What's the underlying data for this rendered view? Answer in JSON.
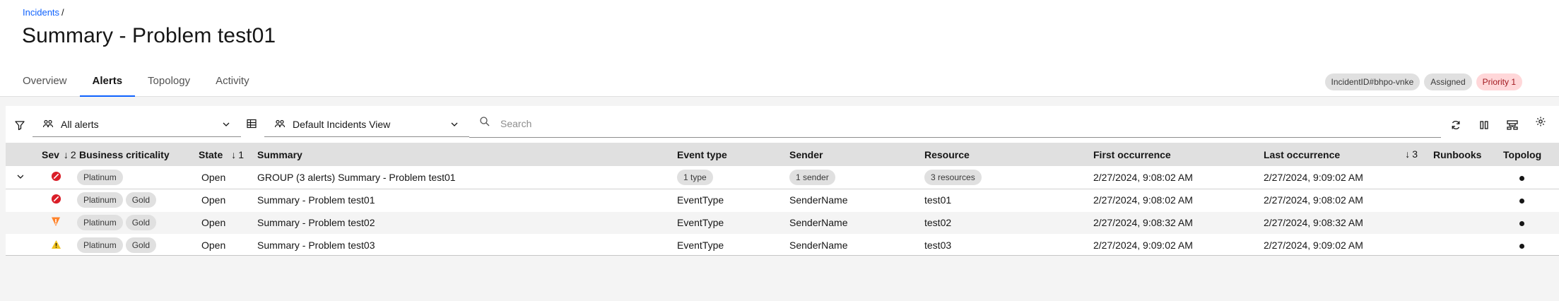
{
  "breadcrumb": {
    "link": "Incidents",
    "separator": "/"
  },
  "title": "Summary - Problem test01",
  "tabs": [
    {
      "label": "Overview",
      "active": false
    },
    {
      "label": "Alerts",
      "active": true
    },
    {
      "label": "Topology",
      "active": false
    },
    {
      "label": "Activity",
      "active": false
    }
  ],
  "tags": [
    {
      "label": "IncidentID#bhpo-vnke",
      "style": "gray"
    },
    {
      "label": "Assigned",
      "style": "gray"
    },
    {
      "label": "Priority 1",
      "style": "red"
    }
  ],
  "toolbar": {
    "filter_icon": "filter-icon",
    "alert_filter": "All alerts",
    "view_icon": "table-icon",
    "view_selector": "Default Incidents View",
    "search_placeholder": "Search",
    "actions": [
      "refresh-icon",
      "columns-icon",
      "group-by-icon",
      "settings-icon"
    ]
  },
  "columns": {
    "sev": "Sev",
    "sev_sort": "2",
    "business_criticality": "Business criticality",
    "state": "State",
    "state_sort": "1",
    "summary": "Summary",
    "event_type": "Event type",
    "sender": "Sender",
    "resource": "Resource",
    "first_occurrence": "First occurrence",
    "last_occurrence": "Last occurrence",
    "last_sort": "3",
    "runbooks": "Runbooks",
    "topology": "Topolog"
  },
  "group_row": {
    "severity": "critical",
    "criticality": [
      "Platinum"
    ],
    "state": "Open",
    "summary": "GROUP (3 alerts) Summary - Problem test01",
    "event_type": "1 type",
    "sender": "1 sender",
    "resource": "3 resources",
    "first_occurrence": "2/27/2024, 9:08:02 AM",
    "last_occurrence": "2/27/2024, 9:09:02 AM"
  },
  "rows": [
    {
      "severity": "critical",
      "criticality": [
        "Platinum",
        "Gold"
      ],
      "state": "Open",
      "summary": "Summary - Problem test01",
      "event_type": "EventType",
      "sender": "SenderName",
      "resource": "test01",
      "first_occurrence": "2/27/2024, 9:08:02 AM",
      "last_occurrence": "2/27/2024, 9:08:02 AM"
    },
    {
      "severity": "major",
      "criticality": [
        "Platinum",
        "Gold"
      ],
      "state": "Open",
      "summary": "Summary - Problem test02",
      "event_type": "EventType",
      "sender": "SenderName",
      "resource": "test02",
      "first_occurrence": "2/27/2024, 9:08:32 AM",
      "last_occurrence": "2/27/2024, 9:08:32 AM"
    },
    {
      "severity": "minor",
      "criticality": [
        "Platinum",
        "Gold"
      ],
      "state": "Open",
      "summary": "Summary - Problem test03",
      "event_type": "EventType",
      "sender": "SenderName",
      "resource": "test03",
      "first_occurrence": "2/27/2024, 9:09:02 AM",
      "last_occurrence": "2/27/2024, 9:09:02 AM"
    }
  ],
  "colors": {
    "link": "#0f62fe",
    "critical": "#da1e28",
    "major": "#ff832b",
    "minor": "#f1c21b",
    "priority_bg": "#ffd7d9",
    "priority_text": "#a2191f"
  }
}
